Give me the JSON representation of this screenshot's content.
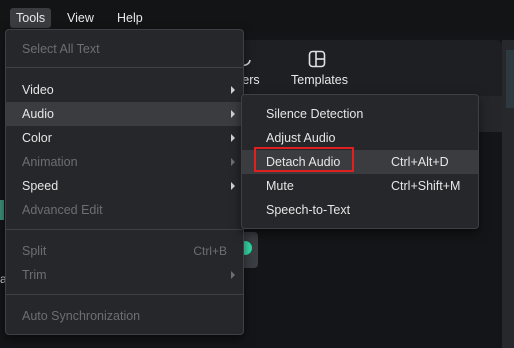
{
  "menubar": {
    "items": [
      "Tools",
      "View",
      "Help"
    ],
    "active": "Tools"
  },
  "toolbar": {
    "partial_label": "kers",
    "templates_label": "Templates"
  },
  "background": {
    "left_fragment": "a"
  },
  "tools_menu": {
    "items": [
      {
        "label": "Select All Text",
        "disabled": true
      },
      {
        "label": "Video",
        "submenu": true
      },
      {
        "label": "Audio",
        "submenu": true,
        "highlighted": true
      },
      {
        "label": "Color",
        "submenu": true
      },
      {
        "label": "Animation",
        "submenu": true,
        "disabled": true
      },
      {
        "label": "Speed",
        "submenu": true
      },
      {
        "label": "Advanced Edit",
        "disabled": true
      },
      {
        "label": "Split",
        "shortcut": "Ctrl+B",
        "disabled": true
      },
      {
        "label": "Trim",
        "submenu": true,
        "disabled": true
      },
      {
        "label": "Auto Synchronization",
        "disabled": true
      }
    ]
  },
  "audio_submenu": {
    "items": [
      {
        "label": "Silence Detection",
        "shortcut": ""
      },
      {
        "label": "Adjust Audio",
        "shortcut": ""
      },
      {
        "label": "Detach Audio",
        "shortcut": "Ctrl+Alt+D",
        "highlighted": true,
        "outlined": true
      },
      {
        "label": "Mute",
        "shortcut": "Ctrl+Shift+M"
      },
      {
        "label": "Speech-to-Text",
        "shortcut": ""
      }
    ]
  },
  "colors": {
    "accent_green": "#38d6a4",
    "focus_outline": "#e02020",
    "menu_bg": "#26272b"
  }
}
